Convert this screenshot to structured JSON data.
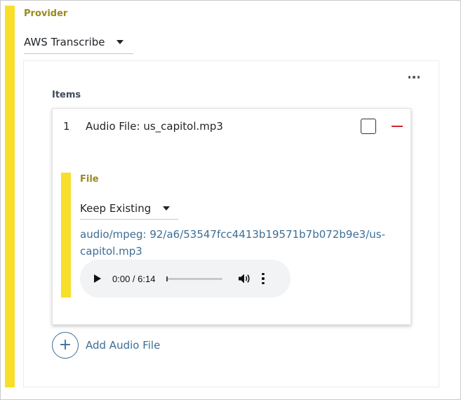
{
  "provider": {
    "label": "Provider",
    "selected": "AWS Transcribe"
  },
  "items_section": {
    "label": "Items",
    "items": [
      {
        "number": "1",
        "title": "Audio File: us_capitol.mp3",
        "file": {
          "label": "File",
          "selected": "Keep Existing",
          "link": "audio/mpeg: 92/a6/53547fcc4413b19571b7b072b9e3/us-capitol.mp3",
          "player": {
            "time": "0:00 / 6:14",
            "progress": 0
          }
        }
      }
    ],
    "add_label": "Add Audio File"
  },
  "colors": {
    "accent_bar": "#f7df2c",
    "label": "#9a8a1e",
    "link": "#3d6e95",
    "remove": "#d0262f"
  },
  "icons": [
    "caret-down-icon",
    "kebab-menu-icon",
    "checkbox-icon",
    "minus-icon",
    "play-icon",
    "volume-icon",
    "more-vertical-icon",
    "plus-circle-icon"
  ]
}
